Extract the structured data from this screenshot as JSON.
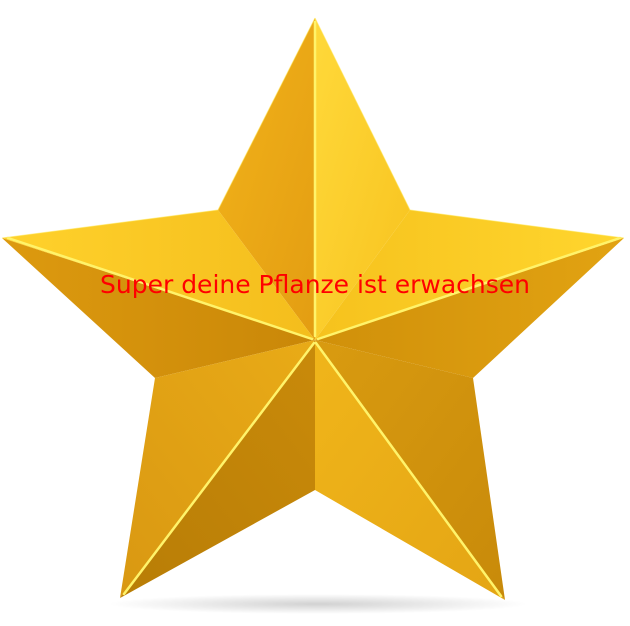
{
  "message": {
    "text": "Super deine Pflanze ist erwachsen",
    "color": "#ff0000"
  },
  "star": {
    "icon": "star-icon",
    "colors": {
      "highlight": "#ffd21a",
      "light": "#f6c21d",
      "mid": "#e9a514",
      "dark": "#c98708",
      "shadow": "#b07406",
      "edge": "#fff36a"
    }
  }
}
